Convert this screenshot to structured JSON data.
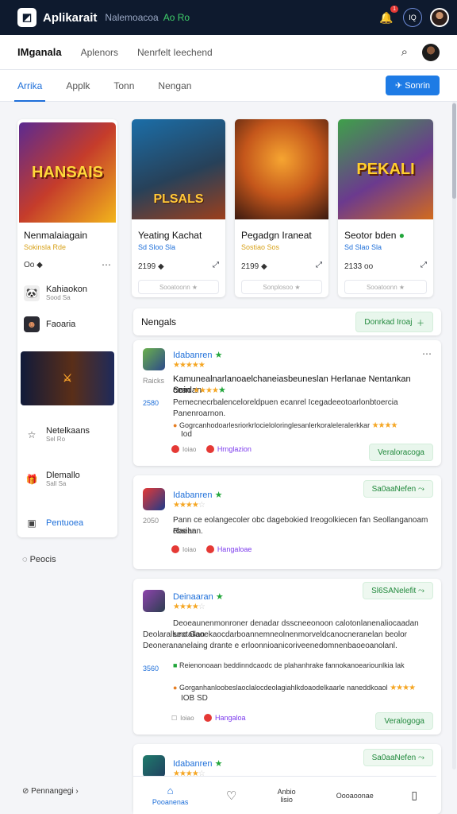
{
  "topbar": {
    "app_name": "Aplikarait",
    "sub1": "Nalemoacoa",
    "sub2": "Ao Ro",
    "badge": "1",
    "circle": "IQ"
  },
  "nav1": {
    "brand": "IMganala",
    "item1": "Aplenors",
    "item2": "Nenrfelt Ieechend"
  },
  "nav2": {
    "tabs": [
      "Arrika",
      "Applk",
      "Tonn",
      "Nengan"
    ],
    "cta": "Sonrin"
  },
  "games": [
    {
      "title": "Nenmalaiagain",
      "sub": "Sokinsla Rde",
      "meta": "Oo ◆",
      "btn": "",
      "art": "HANSAIS"
    },
    {
      "title": "Yeating Kachat",
      "sub": "Sd Sloo Sla",
      "meta": "2199 ◆",
      "btn": "Sooatoonn ★",
      "art": "PLSALS"
    },
    {
      "title": "Pegadgn Iraneat",
      "sub": "Sostiao Sos",
      "meta": "2199 ◆",
      "btn": "Sonplosoo ★",
      "art": ""
    },
    {
      "title": "Seotor bden",
      "sub": "Sd Slao Sla",
      "meta": "2133 oo",
      "btn": "Sooatoonn ★",
      "art": "PEKALI"
    }
  ],
  "sidebar": {
    "items": [
      {
        "label": "Kahiaokon",
        "sub": "Sood Sa"
      },
      {
        "label": "Faoaria",
        "sub": ""
      },
      {
        "label": "Netelkaans",
        "sub": "Sel Ro"
      },
      {
        "label": "Dlemallo",
        "sub": "Sall Sa"
      }
    ],
    "link": "Pentuoea",
    "below": "Peocis",
    "footer": "Pennangegi"
  },
  "section": {
    "title": "Nengals",
    "button": "Donrkad Iroaj"
  },
  "reviews": [
    {
      "name": "Idabanren",
      "num": "Raicks",
      "side": "2580",
      "title": "Kamunealnarlanoaelchaneiasbeuneslan Herlanae Nentankan ceadan",
      "title2": "Soin",
      "line1": "Pemecnecrbalenceloreldpuen ecanrel Icegadeeotoarlonbtoercia",
      "line2": "Panenroarnon.",
      "bullet": "Gogrcanhodoarlesriorkrlocieloloringlesanlerkoraleleralerkkar",
      "bullet2": "Iod",
      "reply": "Ioiao",
      "link": "Hrnglazion",
      "pill": "Veraloracoga"
    },
    {
      "name": "Idabanren",
      "num": "2050",
      "side": "",
      "title": "",
      "title2": "",
      "line1": "Pann ce eolangecoler obc dagebokied Ireogolkiecen fan Seollanganoam ebsian",
      "line2": "Raehan.",
      "bullet": "",
      "bullet2": "",
      "reply": "Ioiao",
      "link": "Hangaloae",
      "pill": "Sa0aaNefen"
    },
    {
      "name": "Deinaaran",
      "num": "",
      "side": "3560",
      "title": "",
      "title2": "",
      "line1": "Deoeaunenmonroner denadar dsscneeonoon calotonlanenaliocaadan seotallan",
      "line2": "Deolarallunc Gaoekaocdarboannemneolnenmorveldcanocneranelan beolor",
      "line3": "Deonerananelaing drante e erloonnioanicoriveenedomnenbaoeoanolanl.",
      "bullet": "Reienonoaan beddinndcaodc de plahanhrake fannokanoeariounlkia lak",
      "bullet2": "Gorganhanloobeslaoclalocdeolagiahlkdoaodelkaarle naneddkoaol",
      "bullet3": "IOB SD",
      "reply": "Ioiao",
      "link": "Hangaloa",
      "pill": "Veralogoga",
      "pill2": "Sl6SANelefit"
    },
    {
      "name": "Idabanren",
      "pill": "Sa0aaNefen"
    }
  ],
  "bottomnav": {
    "items": [
      "Pooanenas",
      "",
      "Anbio lisio",
      "Oooaoonae",
      ""
    ]
  }
}
